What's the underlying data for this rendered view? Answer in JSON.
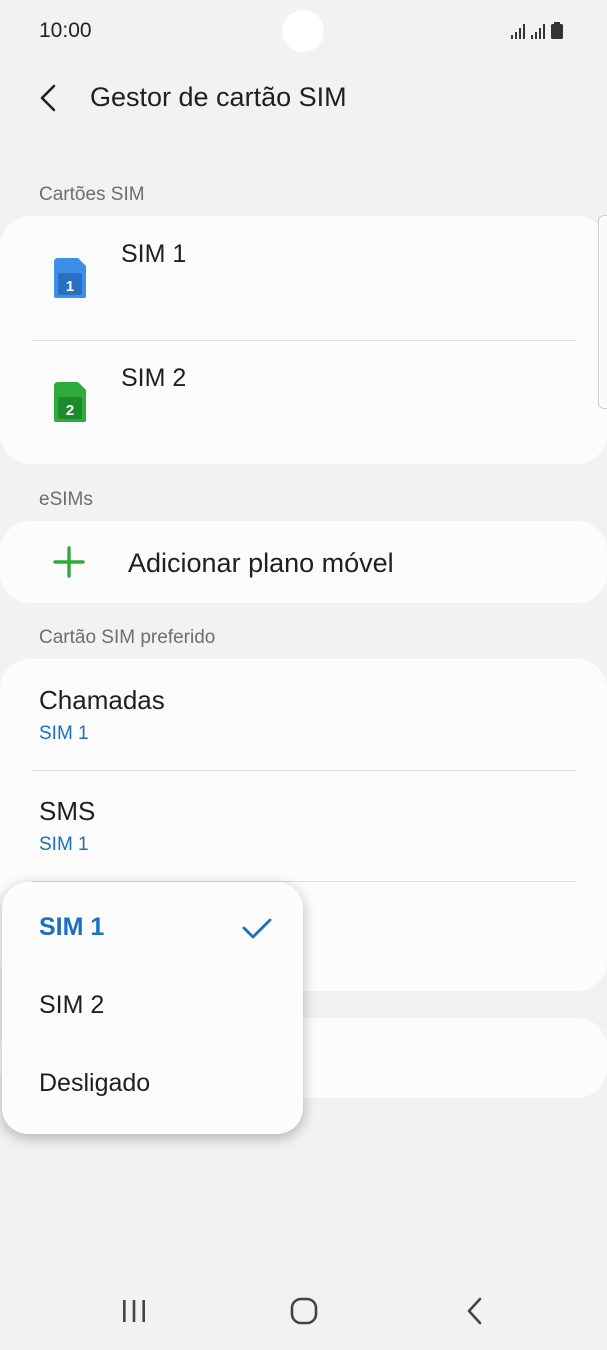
{
  "status_bar": {
    "time": "10:00"
  },
  "app_bar": {
    "title": "Gestor de cartão SIM",
    "back_icon": "chevron-left-icon"
  },
  "sections": {
    "sim_cards": "Cartões SIM",
    "esims": "eSIMs",
    "preferred": "Cartão SIM preferido"
  },
  "sim_cards": [
    {
      "label": "SIM 1",
      "badge": "1",
      "color": "#3b8fe8"
    },
    {
      "label": "SIM 2",
      "badge": "2",
      "color": "#2eab3a"
    }
  ],
  "esim": {
    "add_label": "Adicionar plano móvel",
    "icon": "plus-icon",
    "icon_color": "#2eab3a"
  },
  "preferred": [
    {
      "title": "Chamadas",
      "value": "SIM 1"
    },
    {
      "title": "SMS",
      "value": "SIM 1"
    }
  ],
  "dropdown": {
    "options": [
      "SIM 1",
      "SIM 2",
      "Desligado"
    ],
    "selected": "SIM 1"
  },
  "colors": {
    "accent": "#1b6fbf",
    "background": "#f2f2f2",
    "card": "#fcfcfc"
  },
  "nav_bar": {
    "icons": [
      "recents-icon",
      "home-icon",
      "back-icon"
    ]
  }
}
